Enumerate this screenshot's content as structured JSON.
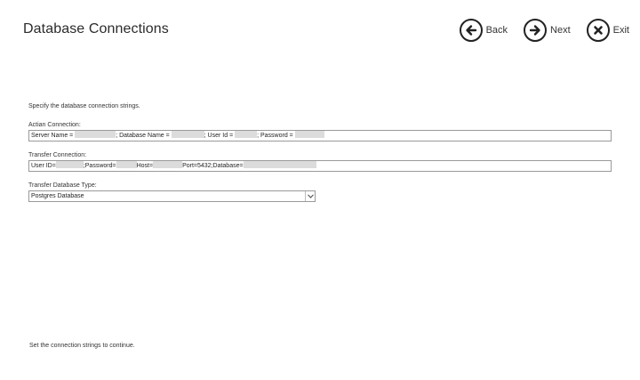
{
  "header": {
    "title": "Database Connections",
    "nav": {
      "back_label": "Back",
      "next_label": "Next",
      "exit_label": "Exit"
    }
  },
  "main": {
    "instruction": "Specify the database connection strings.",
    "actian": {
      "label": "Actian Connection:",
      "segments": [
        "Server Name = ",
        "; Database Name = ",
        "; User Id = ",
        "; Password = "
      ]
    },
    "transfer": {
      "label": "Transfer Connection:",
      "segments": [
        "User ID=",
        ";Password=",
        "Host=",
        "Port=5432;Database="
      ]
    },
    "db_type": {
      "label": "Transfer Database Type:",
      "selected": "Postgres Database"
    }
  },
  "footer": {
    "status": "Set the connection strings to continue."
  },
  "icons": {
    "back": "arrow-left-circle-icon",
    "next": "arrow-right-circle-icon",
    "exit": "close-circle-icon",
    "dropdown": "chevron-down-icon"
  },
  "colors": {
    "text": "#2b2b2b",
    "border": "#9a9a9a",
    "redaction": "#dcdcdc"
  }
}
